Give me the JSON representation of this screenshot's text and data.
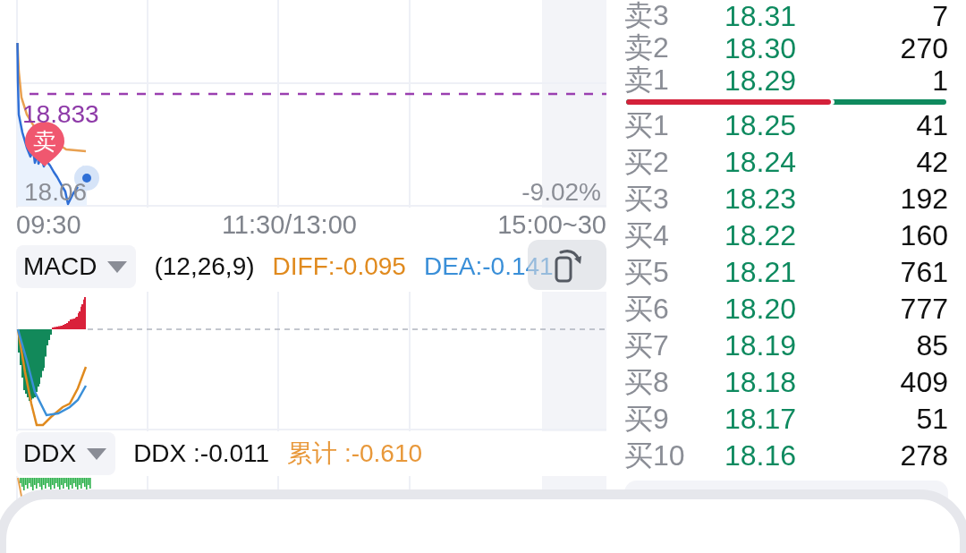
{
  "price_chart": {
    "reference_price": "18.833",
    "trade_marker": "卖",
    "low_price": "18.06",
    "change_percent": "-9.02%",
    "time_axis": [
      "09:30",
      "11:30/13:00",
      "15:00~30"
    ]
  },
  "macd_panel": {
    "indicator": "MACD",
    "params": "(12,26,9)",
    "diff": "DIFF:-0.095",
    "dea": "DEA:-0.141"
  },
  "ddx_panel": {
    "indicator": "DDX",
    "value": "DDX :-0.011",
    "cumulative": "累计 :-0.610"
  },
  "order_book": {
    "asks": [
      {
        "label": "卖3",
        "price": "18.31",
        "volume": "7"
      },
      {
        "label": "卖2",
        "price": "18.30",
        "volume": "270"
      },
      {
        "label": "卖1",
        "price": "18.29",
        "volume": "1"
      }
    ],
    "ratio_bar": {
      "level": 0.64
    },
    "bids": [
      {
        "label": "买1",
        "price": "18.25",
        "volume": "41"
      },
      {
        "label": "买2",
        "price": "18.24",
        "volume": "42"
      },
      {
        "label": "买3",
        "price": "18.23",
        "volume": "192"
      },
      {
        "label": "买4",
        "price": "18.22",
        "volume": "160"
      },
      {
        "label": "买5",
        "price": "18.21",
        "volume": "761"
      },
      {
        "label": "买6",
        "price": "18.20",
        "volume": "777"
      },
      {
        "label": "买7",
        "price": "18.19",
        "volume": "85"
      },
      {
        "label": "买8",
        "price": "18.18",
        "volume": "409"
      },
      {
        "label": "买9",
        "price": "18.17",
        "volume": "51"
      },
      {
        "label": "买10",
        "price": "18.16",
        "volume": "278"
      }
    ]
  }
}
